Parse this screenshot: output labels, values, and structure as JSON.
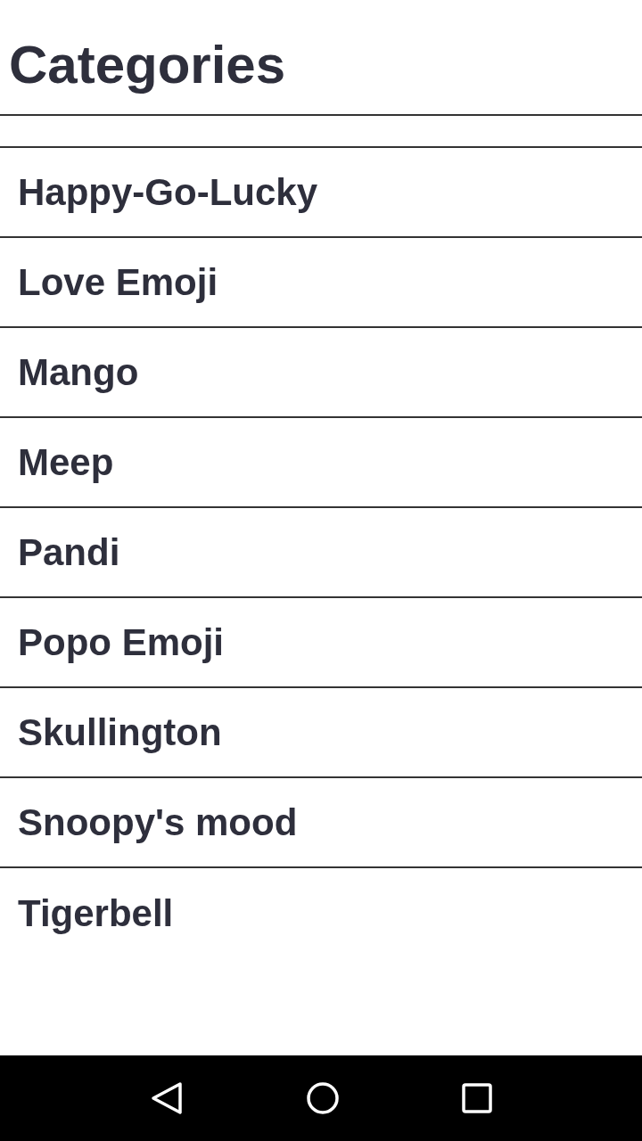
{
  "header": {
    "title": "Categories"
  },
  "categories": [
    {
      "label": "Happy-Go-Lucky"
    },
    {
      "label": "Love Emoji"
    },
    {
      "label": "Mango"
    },
    {
      "label": "Meep"
    },
    {
      "label": "Pandi"
    },
    {
      "label": "Popo Emoji"
    },
    {
      "label": "Skullington"
    },
    {
      "label": "Snoopy's mood"
    },
    {
      "label": "Tigerbell"
    }
  ]
}
